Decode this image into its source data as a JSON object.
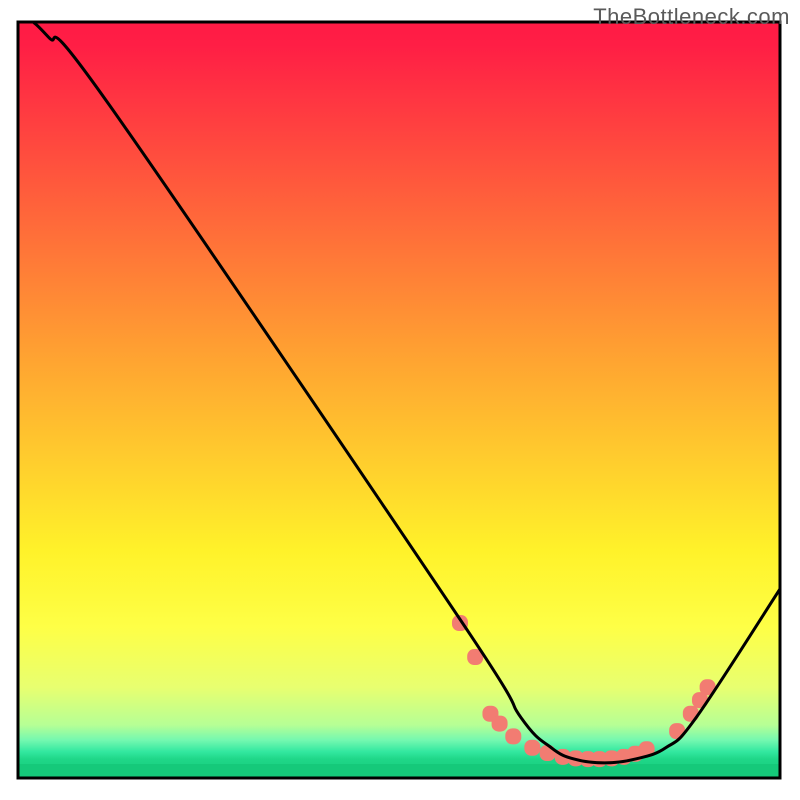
{
  "watermark": {
    "text": "TheBottleneck.com"
  },
  "chart_data": {
    "type": "line",
    "title": "",
    "xlabel": "",
    "ylabel": "",
    "xlim": [
      0,
      100
    ],
    "ylim": [
      0,
      100
    ],
    "grid": false,
    "legend": false,
    "background": {
      "gradient_stops": [
        {
          "pos": 0.0,
          "color": "#ff1b45"
        },
        {
          "pos": 0.03,
          "color": "#ff1e45"
        },
        {
          "pos": 0.45,
          "color": "#ffa531"
        },
        {
          "pos": 0.7,
          "color": "#fff22a"
        },
        {
          "pos": 0.8,
          "color": "#feff46"
        },
        {
          "pos": 0.88,
          "color": "#e8ff70"
        },
        {
          "pos": 0.93,
          "color": "#b6ff95"
        },
        {
          "pos": 0.95,
          "color": "#74f8b0"
        },
        {
          "pos": 0.965,
          "color": "#33e8a0"
        },
        {
          "pos": 0.975,
          "color": "#1fd788"
        },
        {
          "pos": 1.0,
          "color": "#15c97a"
        }
      ]
    },
    "curve": {
      "description": "black bottleneck curve; min ~ (77, 2)",
      "points": [
        {
          "x": 2,
          "y": 100
        },
        {
          "x": 4,
          "y": 98
        },
        {
          "x": 12,
          "y": 89
        },
        {
          "x": 58,
          "y": 21
        },
        {
          "x": 66,
          "y": 8
        },
        {
          "x": 70,
          "y": 4
        },
        {
          "x": 73,
          "y": 2.5
        },
        {
          "x": 77,
          "y": 2
        },
        {
          "x": 81,
          "y": 2.5
        },
        {
          "x": 85,
          "y": 4
        },
        {
          "x": 89,
          "y": 8
        },
        {
          "x": 100,
          "y": 25
        }
      ]
    },
    "highlight_markers": {
      "description": "salmon rounded-rect markers along the valley of the curve",
      "color": "#f27c72",
      "points": [
        {
          "x": 58,
          "y": 20.5
        },
        {
          "x": 60,
          "y": 16
        },
        {
          "x": 62,
          "y": 8.5
        },
        {
          "x": 63.2,
          "y": 7.2
        },
        {
          "x": 65,
          "y": 5.5
        },
        {
          "x": 67.5,
          "y": 4
        },
        {
          "x": 69.5,
          "y": 3.3
        },
        {
          "x": 71.5,
          "y": 2.8
        },
        {
          "x": 73.2,
          "y": 2.6
        },
        {
          "x": 74.8,
          "y": 2.5
        },
        {
          "x": 76.3,
          "y": 2.5
        },
        {
          "x": 77.9,
          "y": 2.6
        },
        {
          "x": 79.5,
          "y": 2.8
        },
        {
          "x": 81,
          "y": 3.2
        },
        {
          "x": 82.5,
          "y": 3.8
        },
        {
          "x": 86.5,
          "y": 6.2
        },
        {
          "x": 88.3,
          "y": 8.5
        },
        {
          "x": 89.5,
          "y": 10.3
        },
        {
          "x": 90.5,
          "y": 12
        }
      ]
    }
  }
}
